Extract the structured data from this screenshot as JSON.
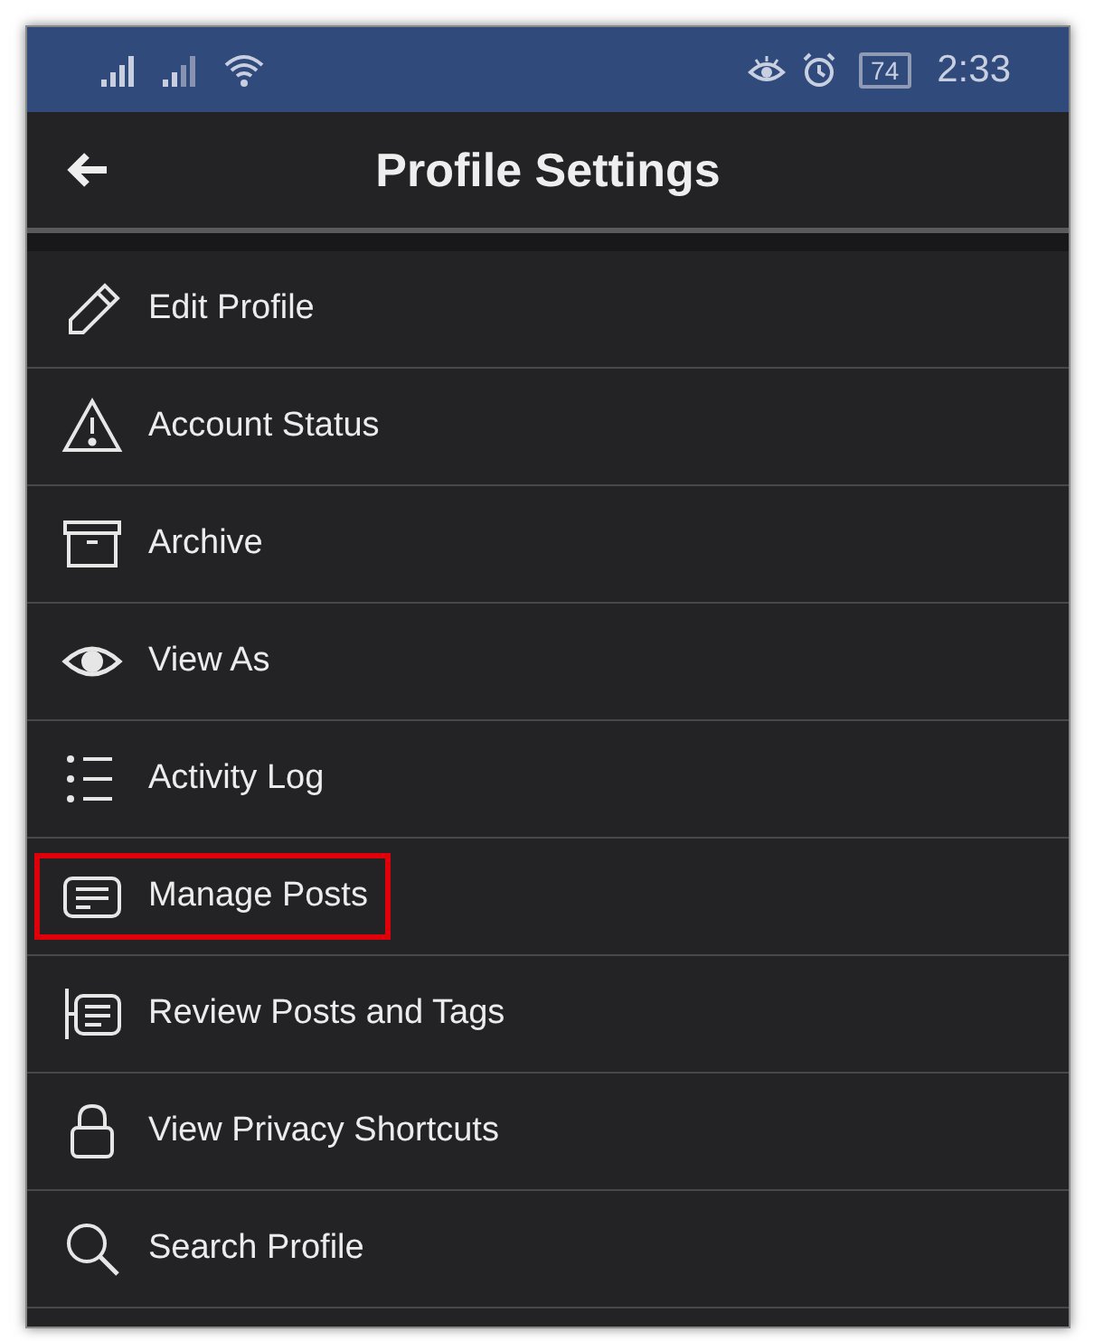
{
  "status_bar": {
    "battery": "74",
    "time": "2:33"
  },
  "header": {
    "title": "Profile Settings"
  },
  "items": [
    {
      "kind": "pencil",
      "label": "Edit Profile",
      "highlighted": false
    },
    {
      "kind": "warning",
      "label": "Account Status",
      "highlighted": false
    },
    {
      "kind": "archive",
      "label": "Archive",
      "highlighted": false
    },
    {
      "kind": "eye",
      "label": "View As",
      "highlighted": false
    },
    {
      "kind": "list",
      "label": "Activity Log",
      "highlighted": false
    },
    {
      "kind": "post",
      "label": "Manage Posts",
      "highlighted": true
    },
    {
      "kind": "review",
      "label": "Review Posts and Tags",
      "highlighted": false
    },
    {
      "kind": "lock",
      "label": "View Privacy Shortcuts",
      "highlighted": false
    },
    {
      "kind": "search",
      "label": "Search Profile",
      "highlighted": false
    }
  ]
}
